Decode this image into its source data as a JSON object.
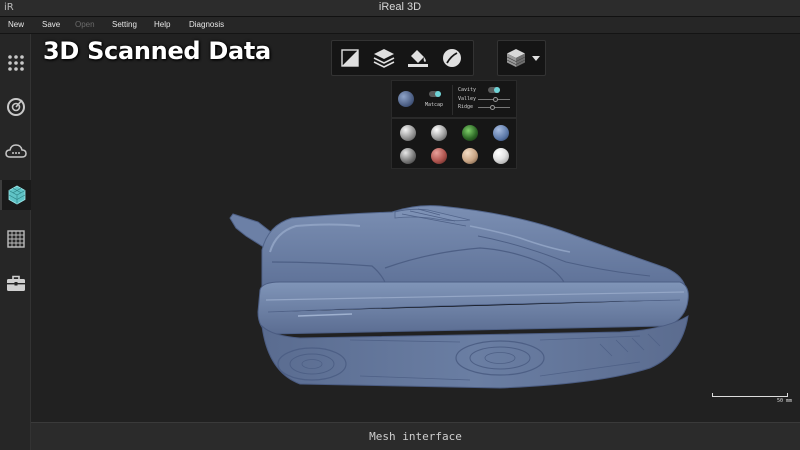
{
  "window": {
    "logo": "iR",
    "title": "iReal 3D"
  },
  "menu": [
    {
      "label": "New",
      "enabled": true
    },
    {
      "label": "Save",
      "enabled": true
    },
    {
      "label": "Open",
      "enabled": false
    },
    {
      "label": "Setting",
      "enabled": true
    },
    {
      "label": "Help",
      "enabled": true
    },
    {
      "label": "Diagnosis",
      "enabled": true
    }
  ],
  "sidebar": {
    "items": [
      {
        "icon": "grid-dots-icon",
        "active": false
      },
      {
        "icon": "scan-target-icon",
        "active": false
      },
      {
        "icon": "cloud-icon",
        "active": false
      },
      {
        "icon": "mesh-cube-icon",
        "active": true
      },
      {
        "icon": "grid-matrix-icon",
        "active": false
      },
      {
        "icon": "toolbox-icon",
        "active": false
      }
    ]
  },
  "overlay": {
    "title": "3D Scanned Data"
  },
  "toolbar": {
    "tools": [
      "triangle-mesh-icon",
      "layers-icon",
      "paint-bucket-icon",
      "material-icon"
    ],
    "view_mode": "shaded-cube-icon"
  },
  "material_panel": {
    "matcap_label": "Matcap",
    "cavity_label": "Cavity",
    "valley_label": "Valley",
    "ridge_label": "Ridge",
    "cavity_on": true,
    "valley_value": 0.55,
    "ridge_value": 0.45,
    "swatch_colors": [
      "#b9b9b9",
      "#cfcfcf",
      "#2f6a28",
      "#5b78a8",
      "#8a8a8a",
      "#b0554f",
      "#c9a585",
      "#e2e2e2"
    ],
    "current_swatch": "#5a6e96"
  },
  "scale": {
    "label": "50 mm"
  },
  "status": {
    "text": "Mesh interface"
  },
  "colors": {
    "mesh": "#6a7fa3",
    "accent": "#6fd3d6"
  }
}
